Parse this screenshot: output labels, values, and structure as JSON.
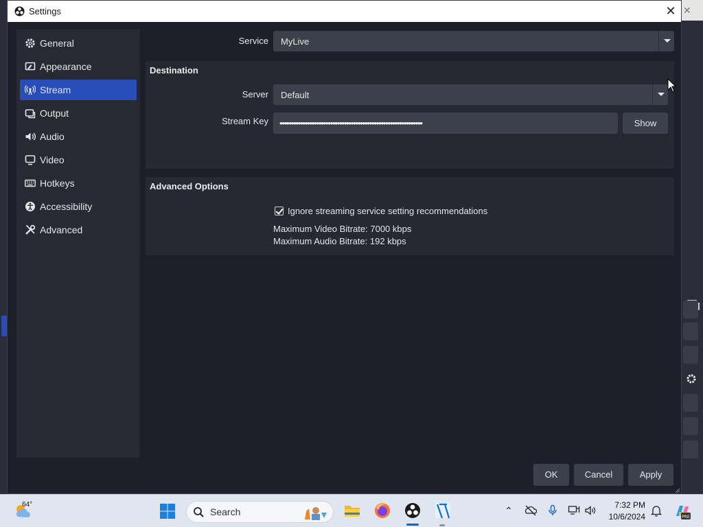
{
  "window": {
    "title": "Settings"
  },
  "sidebar": {
    "items": [
      {
        "label": "General",
        "icon": "gear-icon"
      },
      {
        "label": "Appearance",
        "icon": "appearance-icon"
      },
      {
        "label": "Stream",
        "icon": "broadcast-icon",
        "active": true
      },
      {
        "label": "Output",
        "icon": "output-icon"
      },
      {
        "label": "Audio",
        "icon": "speaker-icon"
      },
      {
        "label": "Video",
        "icon": "monitor-icon"
      },
      {
        "label": "Hotkeys",
        "icon": "keyboard-icon"
      },
      {
        "label": "Accessibility",
        "icon": "accessibility-icon"
      },
      {
        "label": "Advanced",
        "icon": "tools-icon"
      }
    ]
  },
  "stream": {
    "service_label": "Service",
    "service_value": "MyLive",
    "destination_title": "Destination",
    "server_label": "Server",
    "server_value": "Default",
    "stream_key_label": "Stream Key",
    "stream_key_value": "••••••••••••••••••••••••••••••••••••••••••••••••••••••••••••••",
    "show_label": "Show",
    "advanced_title": "Advanced Options",
    "ignore_label": "Ignore streaming service setting recommendations",
    "ignore_checked": true,
    "max_video_bitrate": "Maximum Video Bitrate: 7000 kbps",
    "max_audio_bitrate": "Maximum Audio Bitrate: 192 kbps"
  },
  "buttons": {
    "ok": "OK",
    "cancel": "Cancel",
    "apply": "Apply"
  },
  "taskbar": {
    "weather_temp": "64°",
    "search_placeholder": "Search",
    "time": "7:32 PM",
    "date": "10/6/2024"
  },
  "colors": {
    "accent": "#284cb8",
    "window_bg": "#1d2028",
    "panel_bg": "#262932",
    "field_bg": "#3c404b"
  }
}
